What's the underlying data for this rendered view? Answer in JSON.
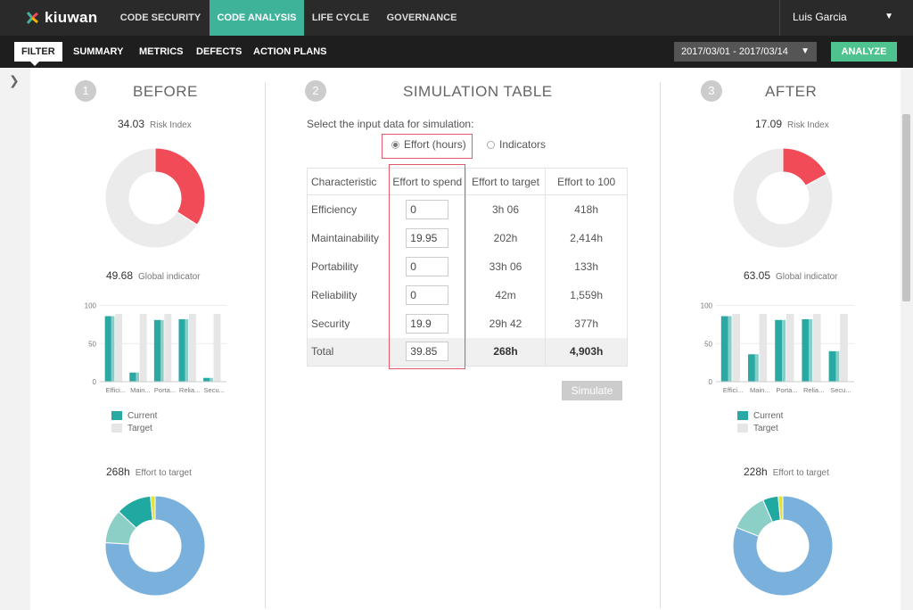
{
  "app": {
    "logo_text": "kiuwan"
  },
  "nav": {
    "items": [
      {
        "label": "CODE SECURITY"
      },
      {
        "label": "CODE ANALYSIS"
      },
      {
        "label": "LIFE CYCLE"
      },
      {
        "label": "GOVERNANCE"
      }
    ],
    "active_index": 1,
    "user_name": "Luis Garcia"
  },
  "subnav": {
    "filter_label": "FILTER",
    "items": [
      {
        "label": "SUMMARY"
      },
      {
        "label": "METRICS"
      },
      {
        "label": "DEFECTS"
      },
      {
        "label": "ACTION PLANS"
      }
    ],
    "date_range": "2017/03/01 - 2017/03/14",
    "analyze_label": "ANALYZE"
  },
  "colors": {
    "accent": "#3fb39a",
    "risk": "#f04b57",
    "ring_bg": "#ebebeb",
    "current": "#2aa9a4",
    "current_light": "#88cdc8",
    "target": "#e6e6e6",
    "effort_main": "#7ab0dc",
    "effort_teal": "#20a9a0",
    "effort_light": "#8ccfc6",
    "effort_yellow": "#e0e040"
  },
  "before": {
    "step": "1",
    "title": "BEFORE",
    "risk_value": "34.03",
    "risk_label": "Risk Index",
    "global_value": "49.68",
    "global_label": "Global indicator",
    "effort_value": "268h",
    "effort_label": "Effort to target",
    "legend_current": "Current",
    "legend_target": "Target"
  },
  "simulation": {
    "step": "2",
    "title": "SIMULATION TABLE",
    "prompt": "Select the input data for simulation:",
    "radio_effort": "Effort (hours)",
    "radio_indicators": "Indicators",
    "headers": [
      "Characteristic",
      "Effort to spend",
      "Effort to target",
      "Effort to 100"
    ],
    "rows": [
      {
        "name": "Efficiency",
        "spend": "0",
        "target": "3h 06",
        "to100": "418h"
      },
      {
        "name": "Maintainability",
        "spend": "19.95",
        "target": "202h",
        "to100": "2,414h"
      },
      {
        "name": "Portability",
        "spend": "0",
        "target": "33h 06",
        "to100": "133h"
      },
      {
        "name": "Reliability",
        "spend": "0",
        "target": "42m",
        "to100": "1,559h"
      },
      {
        "name": "Security",
        "spend": "19.9",
        "target": "29h 42",
        "to100": "377h"
      }
    ],
    "total": {
      "name": "Total",
      "spend": "39.85",
      "target": "268h",
      "to100": "4,903h"
    },
    "simulate_label": "Simulate"
  },
  "after": {
    "step": "3",
    "title": "AFTER",
    "risk_value": "17.09",
    "risk_label": "Risk Index",
    "global_value": "63.05",
    "global_label": "Global indicator",
    "effort_value": "228h",
    "effort_label": "Effort to target",
    "legend_current": "Current",
    "legend_target": "Target"
  },
  "chart_data": [
    {
      "type": "pie",
      "panel": "before-risk",
      "labels": [
        "Risk",
        "Remaining"
      ],
      "values": [
        34.03,
        65.97
      ]
    },
    {
      "type": "bar",
      "panel": "before-global",
      "categories": [
        "Effici...",
        "Main...",
        "Porta...",
        "Relia...",
        "Secu..."
      ],
      "series": [
        {
          "name": "Current",
          "values": [
            86,
            12,
            81,
            82,
            5
          ]
        },
        {
          "name": "Target",
          "values": [
            89,
            89,
            89,
            89,
            89
          ]
        }
      ],
      "yticks": [
        0,
        50,
        100
      ],
      "ylim": [
        0,
        110
      ]
    },
    {
      "type": "pie",
      "panel": "before-effort",
      "values": [
        76,
        11,
        11.5,
        1.5
      ]
    },
    {
      "type": "pie",
      "panel": "after-risk",
      "labels": [
        "Risk",
        "Remaining"
      ],
      "values": [
        17.09,
        82.91
      ]
    },
    {
      "type": "bar",
      "panel": "after-global",
      "categories": [
        "Effici...",
        "Main...",
        "Porta...",
        "Relia...",
        "Secu..."
      ],
      "series": [
        {
          "name": "Current",
          "values": [
            86,
            36,
            81,
            82,
            40
          ]
        },
        {
          "name": "Target",
          "values": [
            89,
            89,
            89,
            89,
            89
          ]
        }
      ],
      "yticks": [
        0,
        50,
        100
      ],
      "ylim": [
        0,
        110
      ]
    },
    {
      "type": "pie",
      "panel": "after-effort",
      "values": [
        81,
        12.5,
        5,
        1.5
      ]
    }
  ]
}
